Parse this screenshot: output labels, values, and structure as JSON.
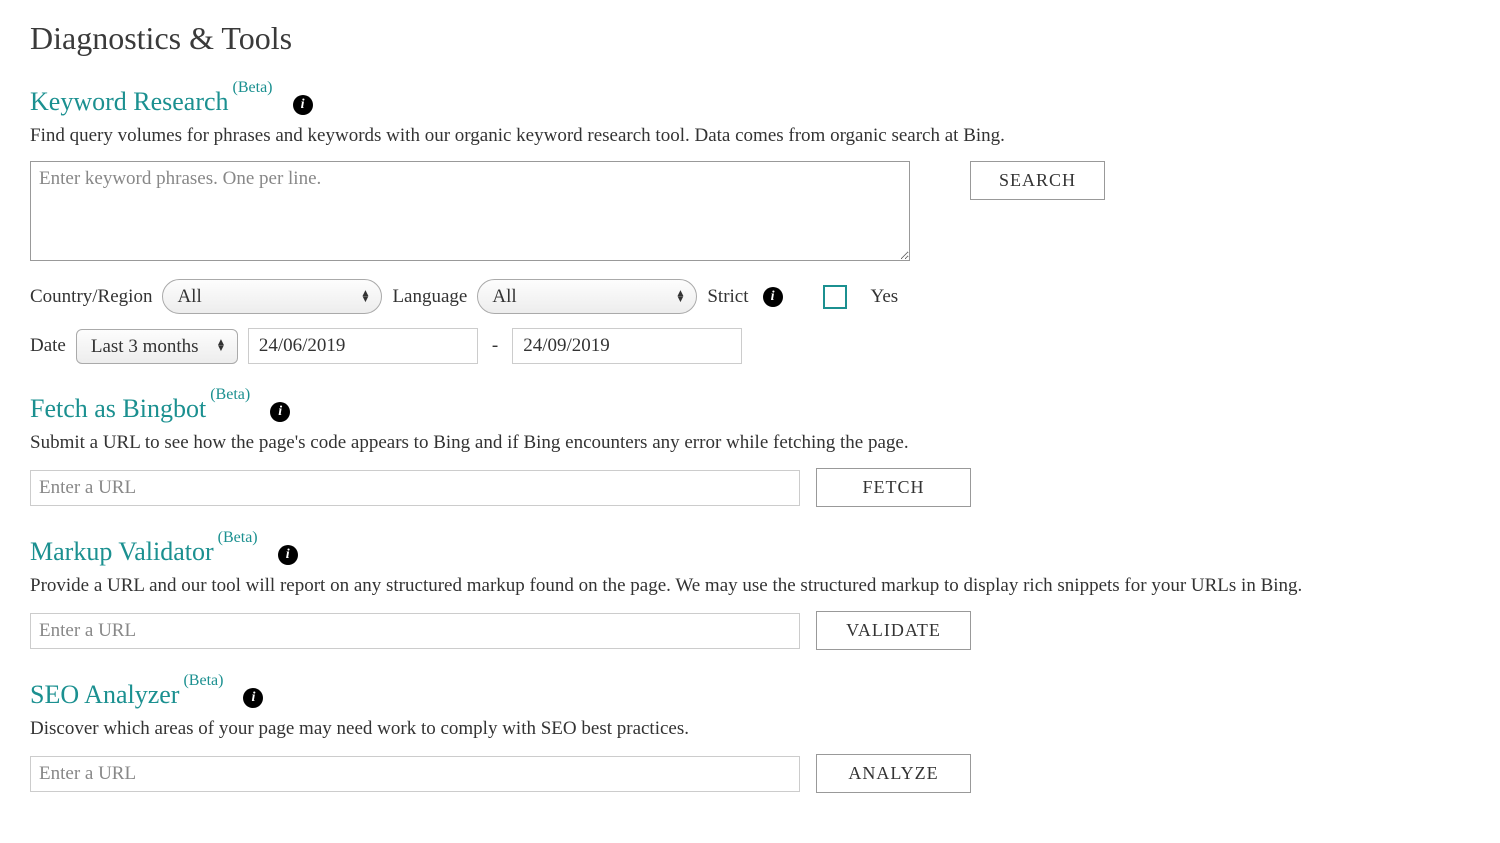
{
  "page_title": "Diagnostics & Tools",
  "beta_label": "(Beta)",
  "keyword_research": {
    "title": "Keyword Research",
    "description": "Find query volumes for phrases and keywords with our organic keyword research tool. Data comes from organic search at Bing.",
    "textarea_placeholder": "Enter keyword phrases. One per line.",
    "search_button": "SEARCH",
    "country_label": "Country/Region",
    "country_value": "All",
    "language_label": "Language",
    "language_value": "All",
    "strict_label": "Strict",
    "yes_label": "Yes",
    "date_label": "Date",
    "date_range_value": "Last 3 months",
    "date_from": "24/06/2019",
    "date_to": "24/09/2019"
  },
  "fetch_bingbot": {
    "title": "Fetch as Bingbot",
    "description": "Submit a URL to see how the page's code appears to Bing and if Bing encounters any error while fetching the page.",
    "url_placeholder": "Enter a URL",
    "button": "FETCH"
  },
  "markup_validator": {
    "title": "Markup Validator",
    "description": "Provide a URL and our tool will report on any structured markup found on the page. We may use the structured markup to display rich snippets for your URLs in Bing.",
    "url_placeholder": "Enter a URL",
    "button": "VALIDATE"
  },
  "seo_analyzer": {
    "title": "SEO Analyzer",
    "description": "Discover which areas of your page may need work to comply with SEO best practices.",
    "url_placeholder": "Enter a URL",
    "button": "ANALYZE"
  }
}
